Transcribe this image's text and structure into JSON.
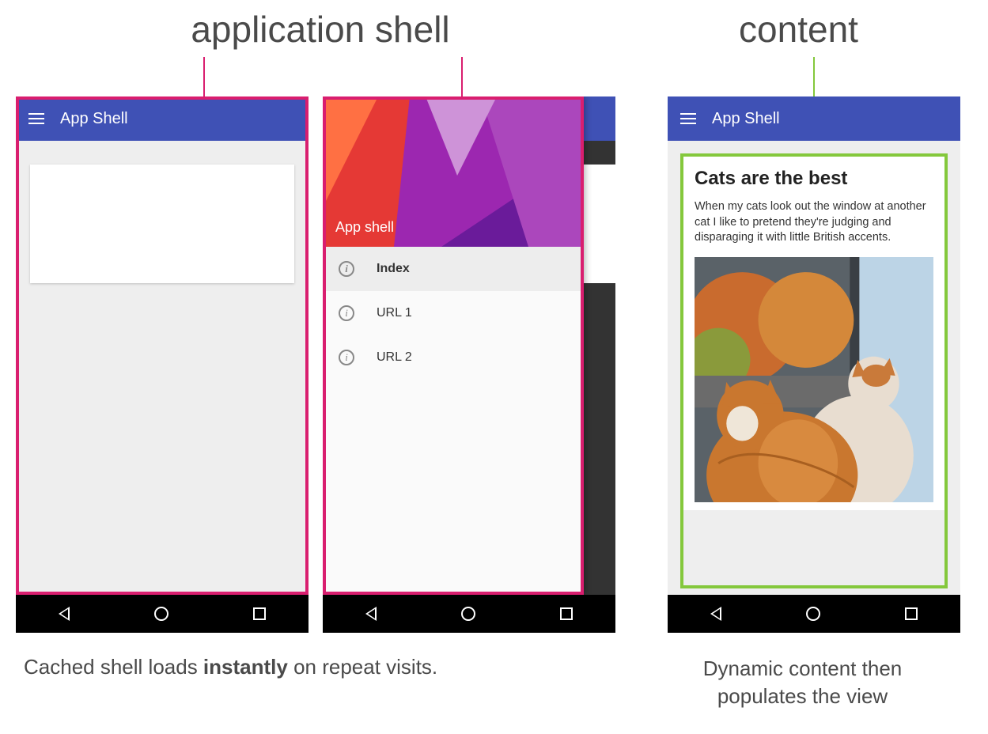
{
  "labels": {
    "shell": "application shell",
    "content": "content"
  },
  "appbar": {
    "title": "App Shell"
  },
  "drawer": {
    "title": "App shell",
    "items": [
      {
        "label": "Index",
        "active": true
      },
      {
        "label": "URL 1",
        "active": false
      },
      {
        "label": "URL 2",
        "active": false
      }
    ]
  },
  "article": {
    "heading": "Cats are the best",
    "body": "When my cats look out the window at another cat I like to pretend they're judging and disparaging it with little British accents."
  },
  "captions": {
    "left_pre": "Cached shell loads ",
    "left_bold": "instantly",
    "left_post": " on repeat visits.",
    "right_line1": "Dynamic content then",
    "right_line2": "populates the view"
  },
  "colors": {
    "outline_shell": "#d91e6f",
    "outline_content": "#84c83c",
    "appbar": "#3f51b5"
  }
}
